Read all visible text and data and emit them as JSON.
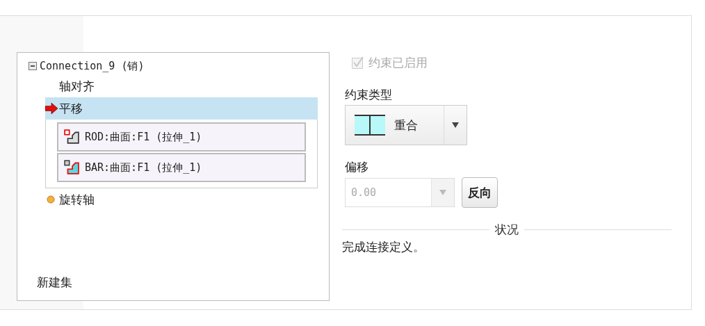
{
  "tree": {
    "root": {
      "label": "Connection_9 (销)",
      "expanded": true,
      "children": [
        {
          "label": "轴对齐",
          "kind": "plain",
          "selected": false
        },
        {
          "label": "平移",
          "kind": "arrow",
          "selected": true,
          "references": [
            {
              "label": "ROD:曲面:F1 (拉伸_1)",
              "kind": "rod"
            },
            {
              "label": "BAR:曲面:F1 (拉伸_1)",
              "kind": "bar"
            }
          ]
        },
        {
          "label": "旋转轴",
          "kind": "dot",
          "selected": false
        }
      ]
    },
    "new_set": "新建集"
  },
  "constraint_enabled": {
    "label": "约束已启用",
    "checked": true,
    "disabled": true
  },
  "constraint_type": {
    "label": "约束类型",
    "value": "重合"
  },
  "offset": {
    "label": "偏移",
    "value": "0.00",
    "disabled": true
  },
  "flip_button": "反向",
  "status": {
    "title": "状况",
    "message": "完成连接定义。"
  }
}
